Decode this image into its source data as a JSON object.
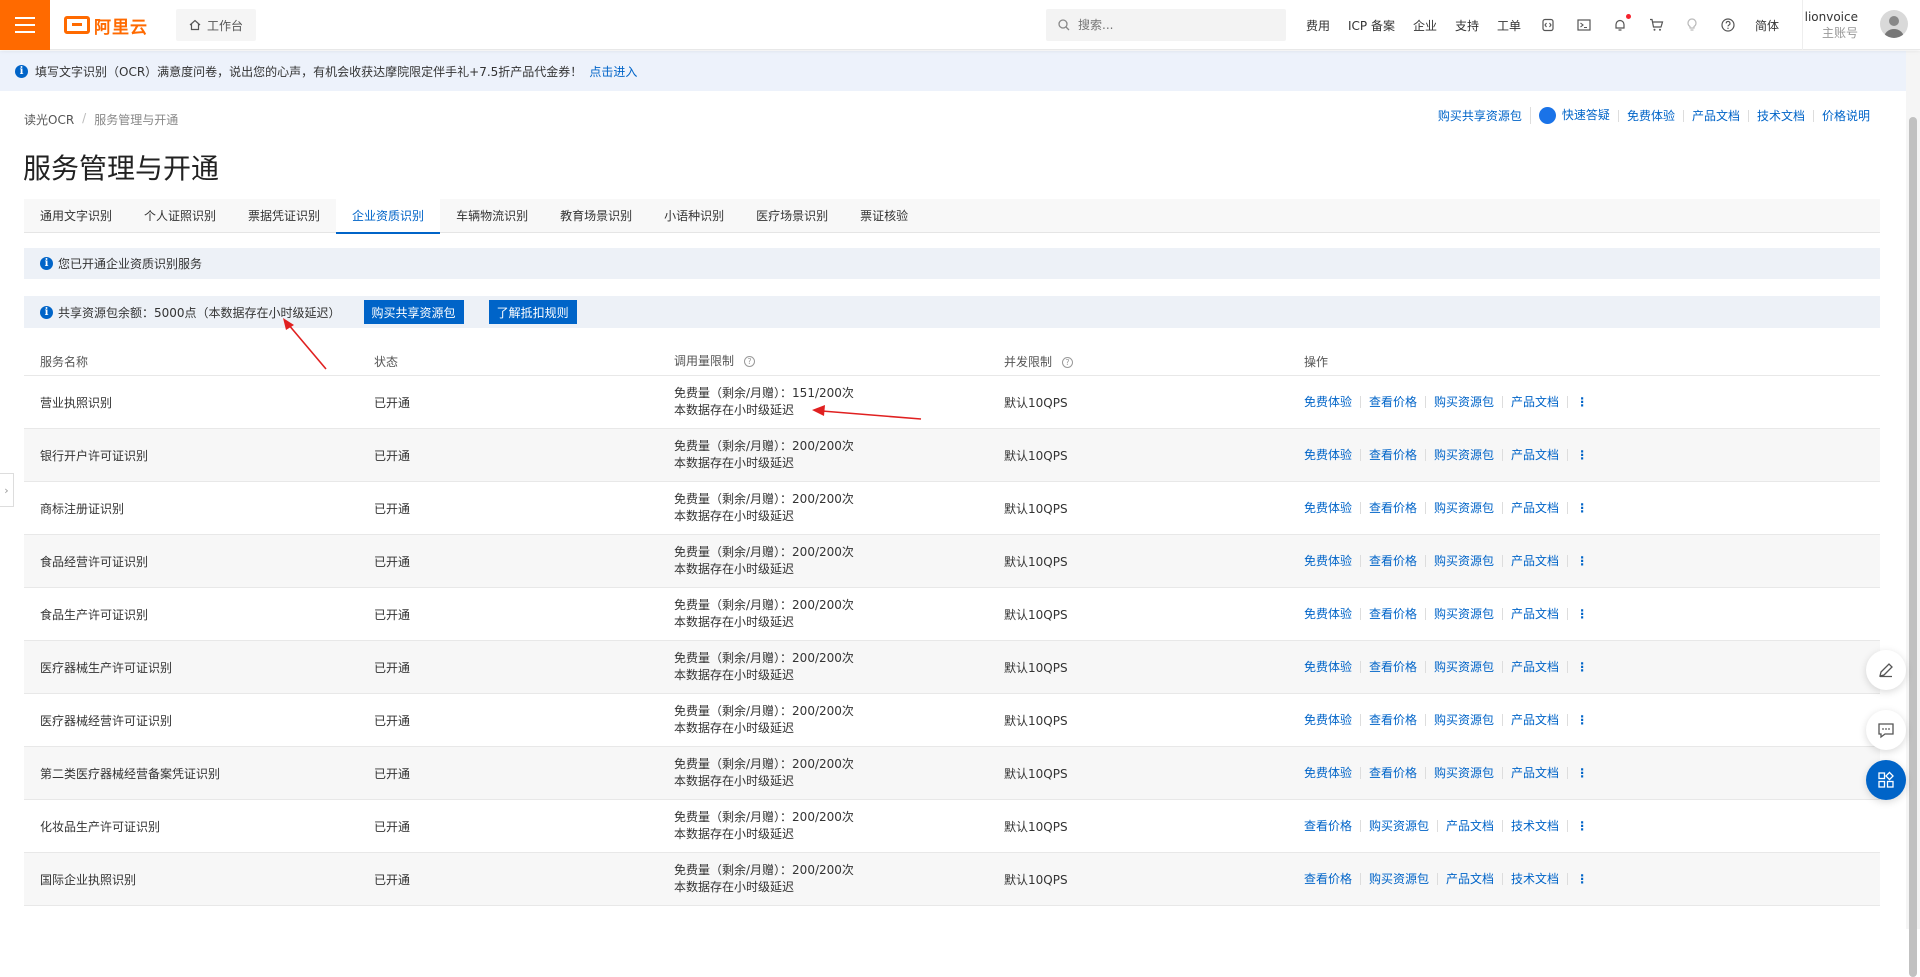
{
  "topbar": {
    "logo_text": "阿里云",
    "workbench": "工作台",
    "search_placeholder": "搜索...",
    "links": [
      "费用",
      "ICP 备案",
      "企业",
      "支持",
      "工单"
    ],
    "lang": "简体",
    "user_name": "lionvoice",
    "user_role": "主账号"
  },
  "notice": {
    "text": "填写文字识别（OCR）满意度问卷，说出您的心声，有机会收获达摩院限定伴手礼+7.5折产品代金券！",
    "link": "点击进入"
  },
  "breadcrumb": {
    "root": "读光OCR",
    "current": "服务管理与开通"
  },
  "right_links": [
    "购买共享资源包",
    "快速答疑",
    "免费体验",
    "产品文档",
    "技术文档",
    "价格说明"
  ],
  "page_title": "服务管理与开通",
  "tabs": [
    "通用文字识别",
    "个人证照识别",
    "票据凭证识别",
    "企业资质识别",
    "车辆物流识别",
    "教育场景识别",
    "小语种识别",
    "医疗场景识别",
    "票证核验"
  ],
  "active_tab": 3,
  "msg_enabled": "您已开通企业资质识别服务",
  "msg_balance": "共享资源包余额：5000点（本数据存在小时级延迟）",
  "btn_buy": "购买共享资源包",
  "btn_rules": "了解抵扣规则",
  "table": {
    "headers": [
      "服务名称",
      "状态",
      "调用量限制",
      "并发限制",
      "操作"
    ],
    "rows": [
      {
        "name": "营业执照识别",
        "status": "已开通",
        "quota": "免费量（剩余/月赠）：151/200次",
        "delay": "本数据存在小时级延迟",
        "qps": "默认10QPS",
        "ops": [
          "免费体验",
          "查看价格",
          "购买资源包",
          "产品文档"
        ]
      },
      {
        "name": "银行开户许可证识别",
        "status": "已开通",
        "quota": "免费量（剩余/月赠）：200/200次",
        "delay": "本数据存在小时级延迟",
        "qps": "默认10QPS",
        "ops": [
          "免费体验",
          "查看价格",
          "购买资源包",
          "产品文档"
        ]
      },
      {
        "name": "商标注册证识别",
        "status": "已开通",
        "quota": "免费量（剩余/月赠）：200/200次",
        "delay": "本数据存在小时级延迟",
        "qps": "默认10QPS",
        "ops": [
          "免费体验",
          "查看价格",
          "购买资源包",
          "产品文档"
        ]
      },
      {
        "name": "食品经营许可证识别",
        "status": "已开通",
        "quota": "免费量（剩余/月赠）：200/200次",
        "delay": "本数据存在小时级延迟",
        "qps": "默认10QPS",
        "ops": [
          "免费体验",
          "查看价格",
          "购买资源包",
          "产品文档"
        ]
      },
      {
        "name": "食品生产许可证识别",
        "status": "已开通",
        "quota": "免费量（剩余/月赠）：200/200次",
        "delay": "本数据存在小时级延迟",
        "qps": "默认10QPS",
        "ops": [
          "免费体验",
          "查看价格",
          "购买资源包",
          "产品文档"
        ]
      },
      {
        "name": "医疗器械生产许可证识别",
        "status": "已开通",
        "quota": "免费量（剩余/月赠）：200/200次",
        "delay": "本数据存在小时级延迟",
        "qps": "默认10QPS",
        "ops": [
          "免费体验",
          "查看价格",
          "购买资源包",
          "产品文档"
        ]
      },
      {
        "name": "医疗器械经营许可证识别",
        "status": "已开通",
        "quota": "免费量（剩余/月赠）：200/200次",
        "delay": "本数据存在小时级延迟",
        "qps": "默认10QPS",
        "ops": [
          "免费体验",
          "查看价格",
          "购买资源包",
          "产品文档"
        ]
      },
      {
        "name": "第二类医疗器械经营备案凭证识别",
        "status": "已开通",
        "quota": "免费量（剩余/月赠）：200/200次",
        "delay": "本数据存在小时级延迟",
        "qps": "默认10QPS",
        "ops": [
          "免费体验",
          "查看价格",
          "购买资源包",
          "产品文档"
        ]
      },
      {
        "name": "化妆品生产许可证识别",
        "status": "已开通",
        "quota": "免费量（剩余/月赠）：200/200次",
        "delay": "本数据存在小时级延迟",
        "qps": "默认10QPS",
        "ops": [
          "查看价格",
          "购买资源包",
          "产品文档",
          "技术文档"
        ]
      },
      {
        "name": "国际企业执照识别",
        "status": "已开通",
        "quota": "免费量（剩余/月赠）：200/200次",
        "delay": "本数据存在小时级延迟",
        "qps": "默认10QPS",
        "ops": [
          "查看价格",
          "购买资源包",
          "产品文档",
          "技术文档"
        ]
      }
    ]
  },
  "colors": {
    "accent": "#0064c8",
    "brand": "#ff6a00",
    "annotation": "#e02020"
  }
}
